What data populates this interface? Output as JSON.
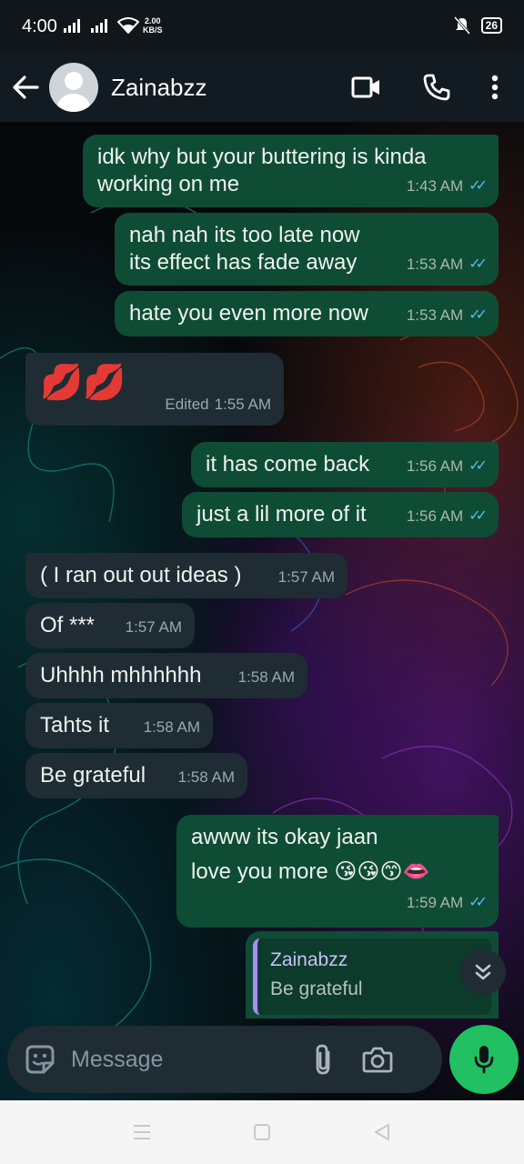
{
  "status_bar": {
    "time": "4:00",
    "speed_value": "2.00",
    "speed_unit": "KB/S",
    "battery": "26"
  },
  "header": {
    "contact_name": "Zainabzz"
  },
  "messages": [
    {
      "dir": "out",
      "lines": [
        "idk why but your buttering is kinda",
        "working on me"
      ],
      "time": "1:43 AM"
    },
    {
      "dir": "out",
      "lines": [
        "nah nah its too late now",
        "its effect has fade away"
      ],
      "time": "1:53 AM"
    },
    {
      "dir": "out",
      "lines": [
        "hate you even more now"
      ],
      "time": "1:53 AM"
    },
    {
      "dir": "in",
      "text": "💋💋",
      "edited_label": "Edited",
      "time": "1:55 AM"
    },
    {
      "dir": "out",
      "lines": [
        "it has come back"
      ],
      "time": "1:56 AM"
    },
    {
      "dir": "out",
      "lines": [
        "just a lil more of it"
      ],
      "time": "1:56 AM"
    },
    {
      "dir": "in",
      "text": "( I ran out out ideas )",
      "time": "1:57 AM"
    },
    {
      "dir": "in",
      "text": "Of ***",
      "time": "1:57 AM"
    },
    {
      "dir": "in",
      "text": "Uhhhh mhhhhhh",
      "time": "1:58 AM"
    },
    {
      "dir": "in",
      "text": "Tahts it",
      "time": "1:58 AM"
    },
    {
      "dir": "in",
      "text": "Be grateful",
      "time": "1:58 AM"
    },
    {
      "dir": "out",
      "lines": [
        "awww its okay jaan",
        "love you more 😘😘😙👄"
      ],
      "time": "1:59 AM"
    }
  ],
  "reply": {
    "name": "Zainabzz",
    "text": "Be grateful"
  },
  "composer": {
    "placeholder": "Message"
  },
  "colors": {
    "outgoing": "#0f4c36",
    "incoming": "#1f2c33",
    "accent": "#21c063",
    "read_ticks": "#53bdeb"
  },
  "icons": [
    "back-arrow-icon",
    "video-call-icon",
    "phone-icon",
    "more-vert-icon",
    "sticker-icon",
    "attach-icon",
    "camera-icon",
    "mic-icon",
    "scroll-down-icon"
  ]
}
